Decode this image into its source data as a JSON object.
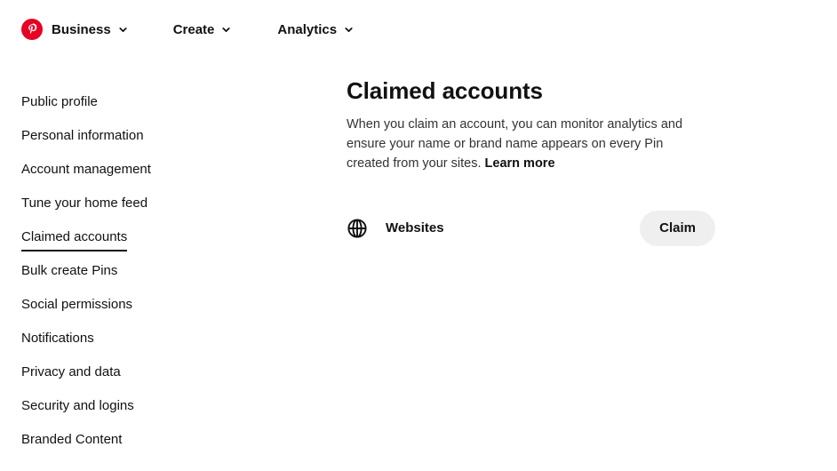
{
  "header": {
    "logo_icon": "pinterest-logo-icon",
    "brand_color": "#e60023",
    "nav": [
      {
        "label": "Business",
        "icon": "chevron-down-icon"
      },
      {
        "label": "Create",
        "icon": "chevron-down-icon"
      },
      {
        "label": "Analytics",
        "icon": "chevron-down-icon"
      }
    ]
  },
  "sidebar": {
    "items": [
      {
        "label": "Public profile",
        "active": false
      },
      {
        "label": "Personal information",
        "active": false
      },
      {
        "label": "Account management",
        "active": false
      },
      {
        "label": "Tune your home feed",
        "active": false
      },
      {
        "label": "Claimed accounts",
        "active": true
      },
      {
        "label": "Bulk create Pins",
        "active": false
      },
      {
        "label": "Social permissions",
        "active": false
      },
      {
        "label": "Notifications",
        "active": false
      },
      {
        "label": "Privacy and data",
        "active": false
      },
      {
        "label": "Security and logins",
        "active": false
      },
      {
        "label": "Branded Content",
        "active": false
      }
    ]
  },
  "main": {
    "title": "Claimed accounts",
    "description": "When you claim an account, you can monitor analytics and ensure your name or brand name appears on every Pin created from your sites.",
    "learn_more_label": "Learn more",
    "accounts": [
      {
        "icon": "globe-icon",
        "label": "Websites",
        "action_label": "Claim",
        "action_bg": "#efefef"
      }
    ]
  }
}
